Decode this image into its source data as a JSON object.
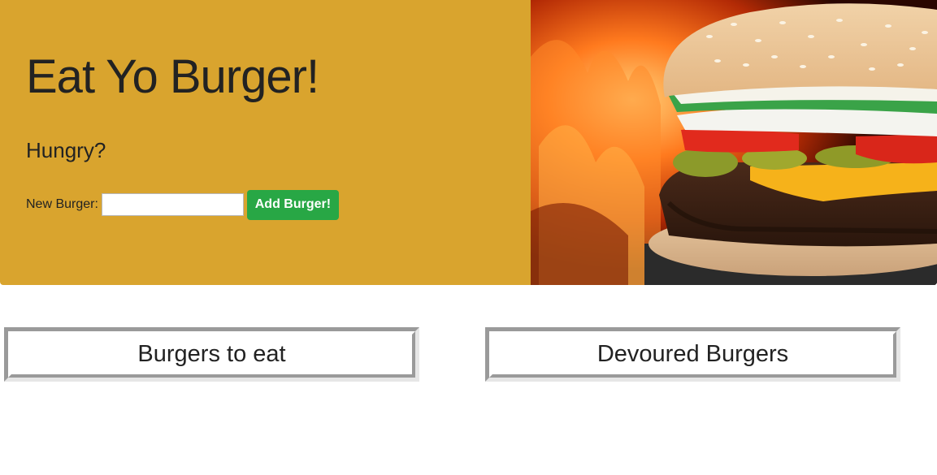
{
  "hero": {
    "title": "Eat Yo Burger!",
    "subtitle": "Hungry?",
    "form": {
      "label": "New Burger:",
      "input_value": "",
      "input_placeholder": "",
      "button_label": "Add Burger!"
    },
    "background_color": "#d9a42e",
    "image": "burger-photo"
  },
  "panels": {
    "to_eat": {
      "title": "Burgers to eat"
    },
    "devoured": {
      "title": "Devoured Burgers"
    }
  },
  "colors": {
    "accent": "#d9a42e",
    "button": "#28a745"
  }
}
